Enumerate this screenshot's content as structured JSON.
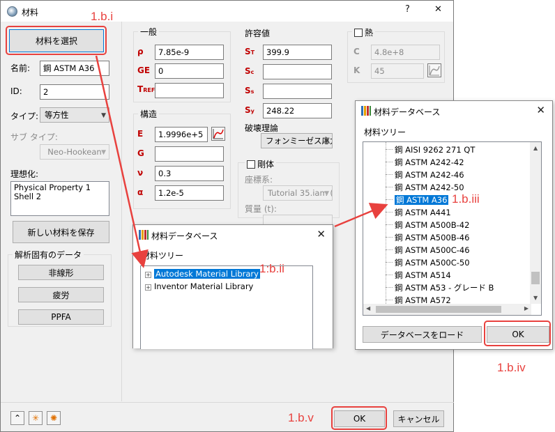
{
  "main_window": {
    "title": "材料",
    "help_label": "?",
    "close_label": "✕",
    "select_material_button": "材料を選択",
    "name_label": "名前:",
    "name_value": "鋼 ASTM A36",
    "id_label": "ID:",
    "id_value": "2",
    "type_label": "タイプ:",
    "type_value": "等方性",
    "subtype_label": "サブ タイプ:",
    "subtype_value": "Neo-Hookean",
    "idealization_label": "理想化:",
    "idealization_items": [
      "Physical Property 1",
      "Shell 2"
    ],
    "save_new_material_button": "新しい材料を保存",
    "analysis_group_title": "解析固有のデータ",
    "nonlinear_button": "非線形",
    "fatigue_button": "疲労",
    "ppfa_button": "PPFA",
    "general": {
      "title": "一般",
      "rho_symbol": "ρ",
      "rho_value": "7.85e-9",
      "ge_symbol": "GE",
      "ge_value": "0",
      "tref_symbol": "T",
      "tref_sub": "REF",
      "tref_value": ""
    },
    "structure": {
      "title": "構造",
      "e_symbol": "E",
      "e_value": "1.9996e+5",
      "g_symbol": "G",
      "g_value": "",
      "nu_symbol": "ν",
      "nu_value": "0.3",
      "alpha_symbol": "α",
      "alpha_value": "1.2e-5"
    },
    "allowables": {
      "title": "許容値",
      "st_symbol": "S",
      "st_sub": "T",
      "st_value": "399.9",
      "sc_symbol": "S",
      "sc_sub": "c",
      "sc_value": "",
      "ss_symbol": "S",
      "ss_sub": "s",
      "ss_value": "",
      "sy_symbol": "S",
      "sy_sub": "y",
      "sy_value": "248.22",
      "failure_theory_label": "破壊理論",
      "failure_theory_value": "フォンミーゼス応力"
    },
    "thermal": {
      "title": "熱",
      "c_symbol": "C",
      "c_value": "4.8e+8",
      "k_symbol": "K",
      "k_value": "45"
    },
    "rigid": {
      "title": "剛体",
      "coord_label": "座標系:",
      "coord_value": "Tutorial 35.iam (",
      "mass_label": "質量 (t):"
    },
    "ok_button": "OK",
    "cancel_button": "キャンセル"
  },
  "db_dialog_small": {
    "title": "材料データベース",
    "tree_label": "材料ツリー",
    "items": [
      "Autodesk Material Library",
      "Inventor Material Library"
    ]
  },
  "db_dialog_large": {
    "title": "材料データベース",
    "tree_label": "材料ツリー",
    "items": [
      "鋼 AISI 9262 271 QT",
      "鋼 ASTM A242-42",
      "鋼 ASTM A242-46",
      "鋼 ASTM A242-50",
      "鋼 ASTM A36",
      "鋼 ASTM A441",
      "鋼 ASTM A500B-42",
      "鋼 ASTM A500B-46",
      "鋼 ASTM A500C-46",
      "鋼 ASTM A500C-50",
      "鋼 ASTM A514",
      "鋼 ASTM A53 - グレード B",
      "鋼 ASTM A572"
    ],
    "selected_index": 4,
    "load_database_button": "データベースをロード",
    "ok_button": "OK"
  },
  "annotations": {
    "step_i": "1.b.i",
    "step_ii": "1:b.ii",
    "step_iii": "1.b.iii",
    "step_iv": "1.b.iv",
    "step_v": "1.b.v"
  },
  "colors": {
    "annotation_red": "#e8413e",
    "selection_blue": "#0078d7",
    "symbol_red": "#c00000"
  }
}
